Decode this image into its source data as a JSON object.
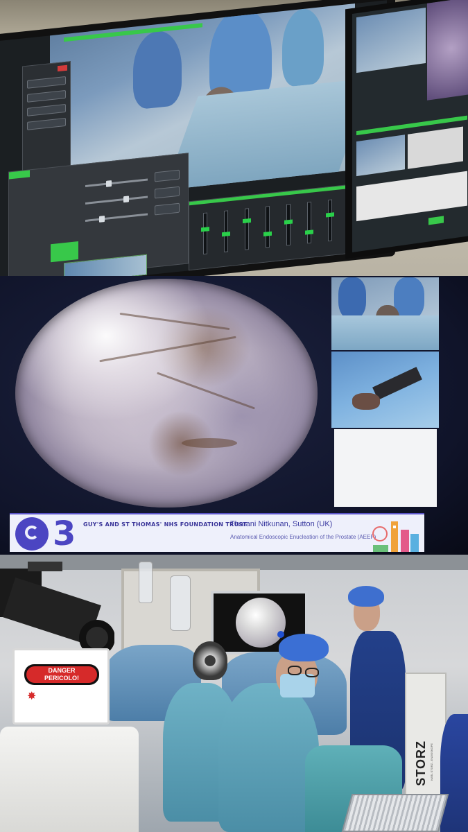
{
  "banner": {
    "logo_number": "3",
    "trust_name": "GUY'S AND ST THOMAS' NHS FOUNDATION TRUST",
    "speaker": "Tharani Nitkunan, Sutton  (UK)",
    "topic": "Anatomical Endoscopic Enucleation of the Prostate (AEEP)"
  },
  "danger_sign": {
    "title": "DANGER",
    "subtitle": "PERICOLO!"
  },
  "equipment": {
    "brand": "STORZ",
    "brand_sub": "KARL STORZ - ENDOSKOPE"
  },
  "colors": {
    "banner_accent": "#4b45c2",
    "console_green": "#38c84a",
    "danger_red": "#d62a2a",
    "scrub_blue": "#4b8ea6"
  },
  "icons": [
    "headset-icon",
    "laser-warning-icon"
  ]
}
